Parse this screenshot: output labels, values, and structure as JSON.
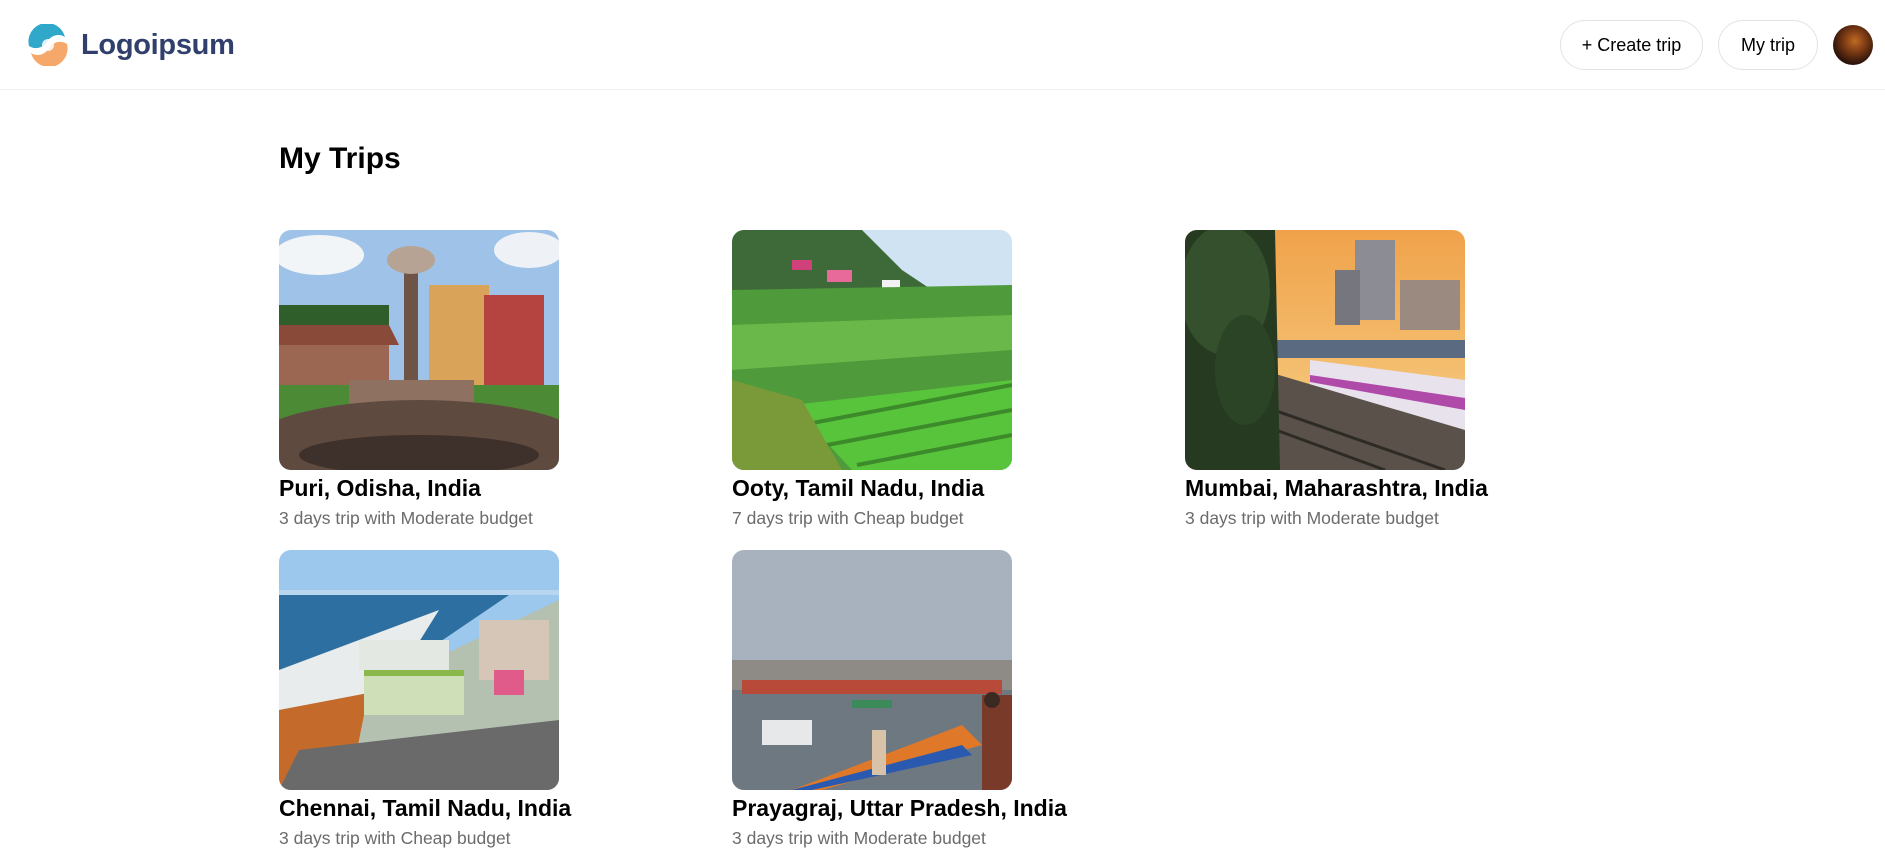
{
  "header": {
    "logo_text": "Logoipsum",
    "create_trip_label": "+ Create trip",
    "my_trip_label": "My trip",
    "avatar_icon": "user-avatar"
  },
  "colors": {
    "logo_text": "#303f6b",
    "border": "#e3e3e3",
    "subtitle": "#6b6b6b"
  },
  "main": {
    "title": "My Trips",
    "trips": [
      {
        "location": "Puri, Odisha, India",
        "summary": "3 days trip with Moderate budget",
        "image": "fountain-garden-photo"
      },
      {
        "location": "Ooty, Tamil Nadu, India",
        "summary": "7 days trip with Cheap budget",
        "image": "terraced-hills-photo"
      },
      {
        "location": "Mumbai, Maharashtra, India",
        "summary": "3 days trip with Moderate budget",
        "image": "train-station-sunset-photo"
      },
      {
        "location": "Chennai, Tamil Nadu, India",
        "summary": "3 days trip with Cheap budget",
        "image": "coastal-city-aerial-photo"
      },
      {
        "location": "Prayagraj, Uttar Pradesh, India",
        "summary": "3 days trip with Moderate budget",
        "image": "river-ghats-boats-photo"
      }
    ]
  }
}
